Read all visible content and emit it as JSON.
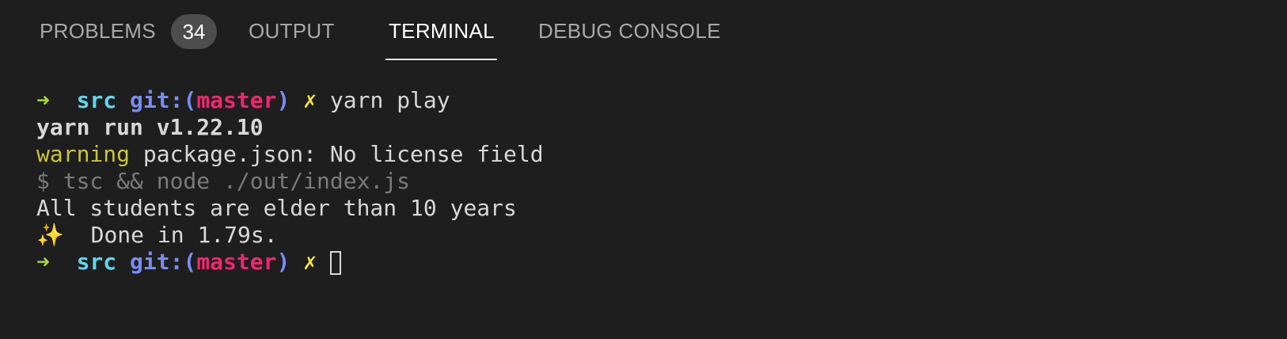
{
  "tabs": {
    "problems": "PROBLEMS",
    "problems_count": "34",
    "output": "OUTPUT",
    "terminal": "TERMINAL",
    "debug_console": "DEBUG CONSOLE",
    "active": "terminal"
  },
  "terminal": {
    "prompt": {
      "arrow": "➜",
      "dir": "src",
      "git_label": "git:(",
      "branch": "master",
      "git_close": ")",
      "dirty_mark": "✗"
    },
    "command": "yarn play",
    "lines": {
      "yarn_run": "yarn run v1.22.10",
      "warning_label": "warning",
      "warning_text": " package.json: No license field",
      "script": "$ tsc && node ./out/index.js",
      "output": "All students are elder than 10 years",
      "done_icon": "✨",
      "done_text": "  Done in 1.79s."
    }
  },
  "colors": {
    "background": "#1e1e1e",
    "arrow": "#a6d837",
    "dir": "#5fd7ef",
    "git": "#7a8cf4",
    "branch": "#f0266f",
    "dirty": "#f3e53d",
    "warning": "#c9c53a"
  }
}
